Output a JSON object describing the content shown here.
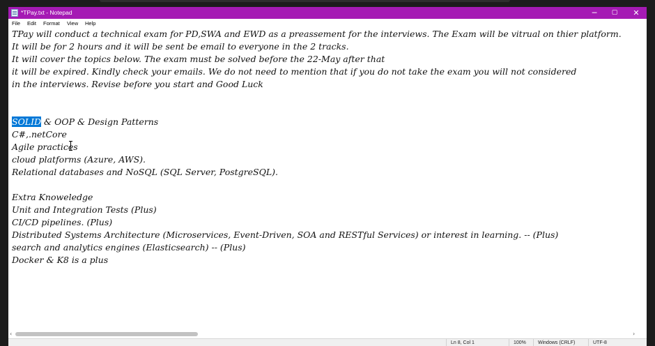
{
  "window": {
    "title": "*TPay.txt - Notepad",
    "accent_color": "#a51ab4",
    "controls": {
      "minimize": "─",
      "maximize": "▢",
      "close": "✕"
    }
  },
  "menu": [
    "File",
    "Edit",
    "Format",
    "View",
    "Help"
  ],
  "document": {
    "lines": [
      "TPay will conduct a technical exam for PD,SWA and EWD as a preassement for the interviews. The Exam will be vitrual on thier platform.",
      "It will be for 2 hours and it will be sent be email to everyone in the 2 tracks.",
      "It will cover the topics below. The exam must be solved before the 22-May after that",
      "it will be expired. Kindly check your emails. We do not need to mention that if you do not take the exam you will not considered",
      "in the interviews. Revise before you start and Good Luck",
      "",
      "",
      "SOLID & OOP & Design Patterns",
      "C#,.netCore",
      "Agile practices",
      "cloud platforms (Azure, AWS).",
      "Relational databases and NoSQL (SQL Server, PostgreSQL).",
      "",
      "Extra Knoweledge",
      "Unit and Integration Tests (Plus)",
      "CI/CD pipelines. (Plus)",
      "Distributed Systems Architecture (Microservices, Event-Driven, SOA and RESTful Services) or interest in learning. -- (Plus)",
      "search and analytics engines (Elasticsearch) -- (Plus)",
      "Docker & K8 is a plus"
    ],
    "selection": {
      "line_index": 7,
      "selected_text": "SOLID",
      "rest_text": " & OOP & Design Patterns"
    }
  },
  "scrollbar": {
    "left_arrow": "‹",
    "right_arrow": "›"
  },
  "status": {
    "position": "Ln 8, Col 1",
    "zoom": "100%",
    "line_ending": "Windows (CRLF)",
    "encoding": "UTF-8"
  },
  "icons": [
    "notepad-app-icon",
    "text-cursor-ibeam-icon"
  ]
}
